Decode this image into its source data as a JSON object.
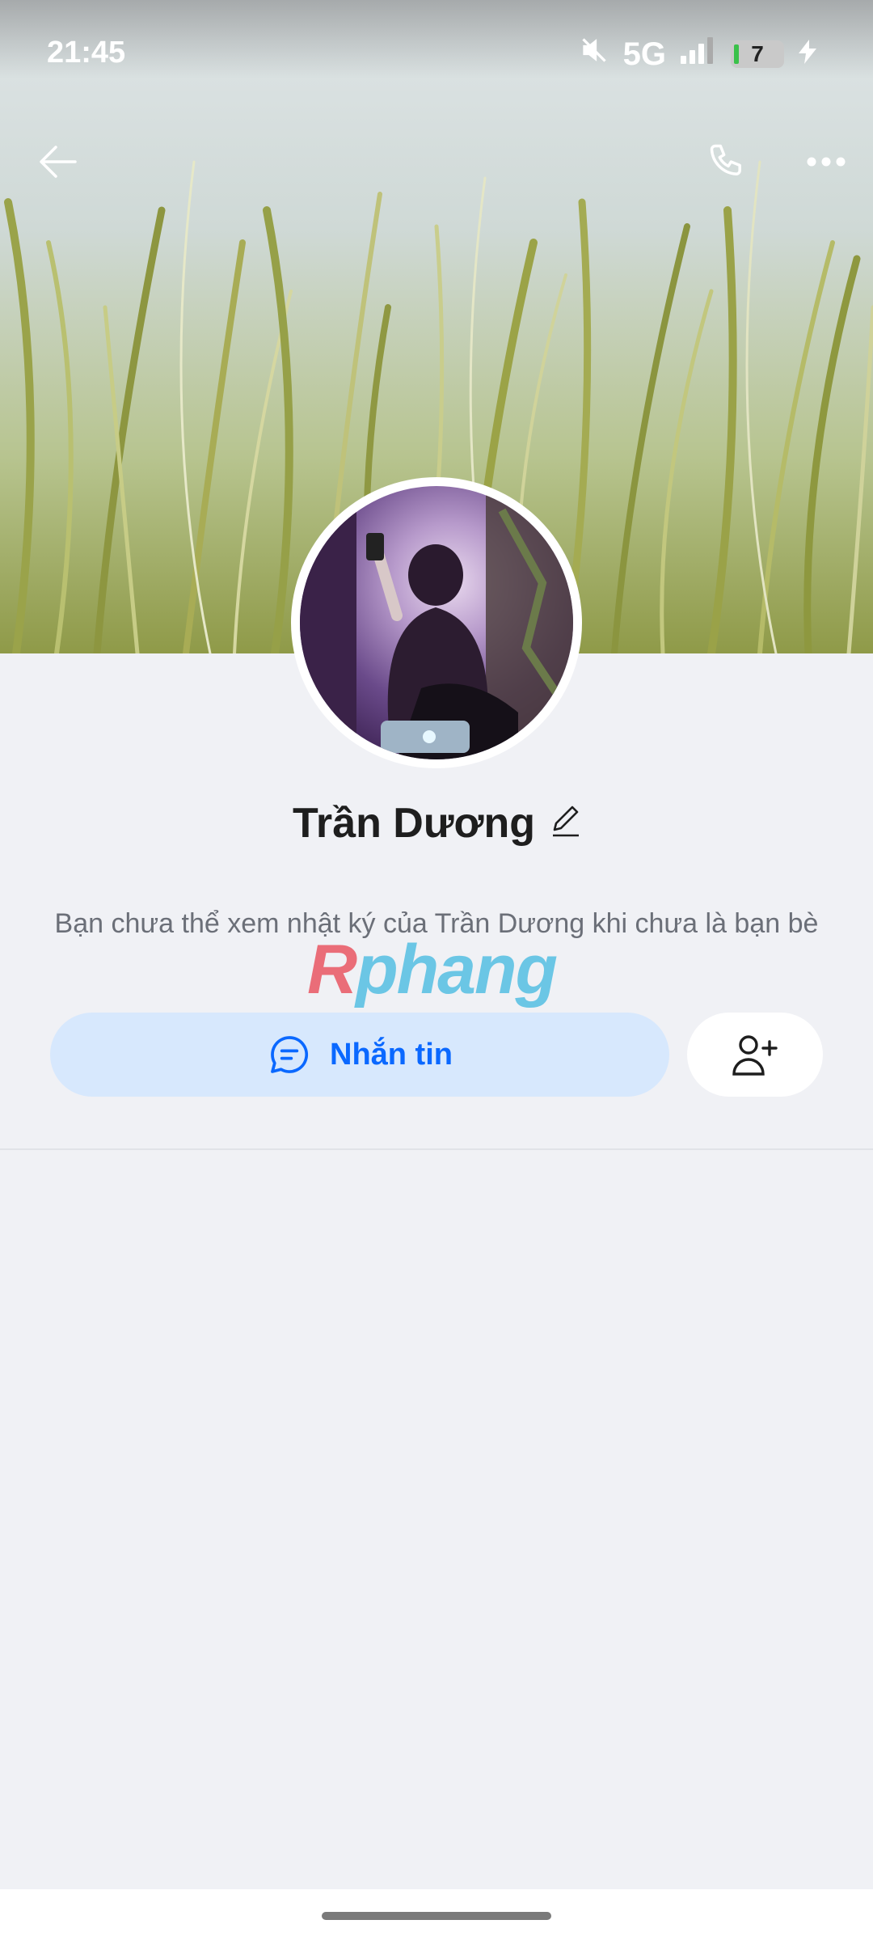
{
  "status_bar": {
    "time": "21:45",
    "network": "5G",
    "battery": "7"
  },
  "profile": {
    "name": "Trần Dương",
    "privacy_message": "Bạn chưa thể xem nhật ký của Trần Dương khi chưa là bạn bè"
  },
  "actions": {
    "message_label": "Nhắn tin"
  },
  "watermark": {
    "first_letter": "R",
    "rest": "phang"
  },
  "colors": {
    "accent": "#0a68ff",
    "message_button_bg": "#d7e8fd",
    "background": "#f0f1f5"
  },
  "icons": {
    "back": "arrow-left-icon",
    "call": "phone-icon",
    "more": "more-horizontal-icon",
    "edit": "pencil-icon",
    "message": "chat-bubble-icon",
    "add_friend": "user-plus-icon"
  }
}
